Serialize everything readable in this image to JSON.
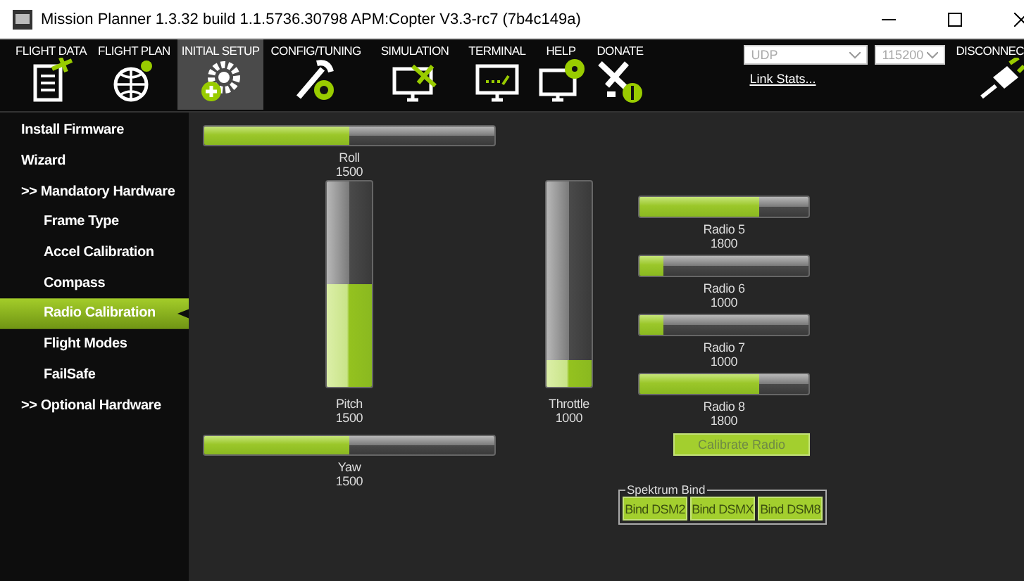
{
  "window": {
    "title": "Mission Planner 1.3.32 build 1.1.5736.30798 APM:Copter V3.3-rc7 (7b4c149a)"
  },
  "toolbar": {
    "items": [
      {
        "label": "FLIGHT DATA",
        "selected": false
      },
      {
        "label": "FLIGHT PLAN",
        "selected": false
      },
      {
        "label": "INITIAL SETUP",
        "selected": true
      },
      {
        "label": "CONFIG/TUNING",
        "selected": false
      },
      {
        "label": "SIMULATION",
        "selected": false
      },
      {
        "label": "TERMINAL",
        "selected": false
      },
      {
        "label": "HELP",
        "selected": false
      },
      {
        "label": "DONATE",
        "selected": false
      }
    ],
    "port": "UDP",
    "baud": "115200",
    "link_stats": "Link Stats...",
    "disconnect": "DISCONNEC"
  },
  "sidebar": {
    "items": [
      {
        "label": "Install Firmware",
        "selected": false
      },
      {
        "label": "Wizard",
        "selected": false
      },
      {
        "label": ">> Mandatory Hardware",
        "selected": false,
        "children": [
          {
            "label": "Frame Type",
            "selected": false
          },
          {
            "label": "Accel Calibration",
            "selected": false
          },
          {
            "label": "Compass",
            "selected": false
          },
          {
            "label": "Radio Calibration",
            "selected": true
          },
          {
            "label": "Flight Modes",
            "selected": false
          },
          {
            "label": "FailSafe",
            "selected": false
          }
        ]
      },
      {
        "label": ">> Optional Hardware",
        "selected": false
      }
    ]
  },
  "sticks": [
    {
      "name": "Roll",
      "value": "1500",
      "level": 0.5,
      "kind": "horizontal"
    },
    {
      "name": "Pitch",
      "value": "1500",
      "level": 0.5,
      "kind": "vertical"
    },
    {
      "name": "Yaw",
      "value": "1500",
      "level": 0.5,
      "kind": "horizontal"
    },
    {
      "name": "Throttle",
      "value": "1000",
      "level": 0.13,
      "kind": "vertical"
    }
  ],
  "radios": [
    {
      "name": "Radio 5",
      "value": "1800",
      "level": 0.71
    },
    {
      "name": "Radio 6",
      "value": "1000",
      "level": 0.14
    },
    {
      "name": "Radio 7",
      "value": "1000",
      "level": 0.14
    },
    {
      "name": "Radio 8",
      "value": "1800",
      "level": 0.71
    }
  ],
  "calibrate_button": {
    "label": "Calibrate Radio",
    "disabled": true
  },
  "spektrum_bind": {
    "title": "Spektrum Bind",
    "buttons": [
      "Bind DSM2",
      "Bind DSMX",
      "Bind DSM8"
    ]
  }
}
